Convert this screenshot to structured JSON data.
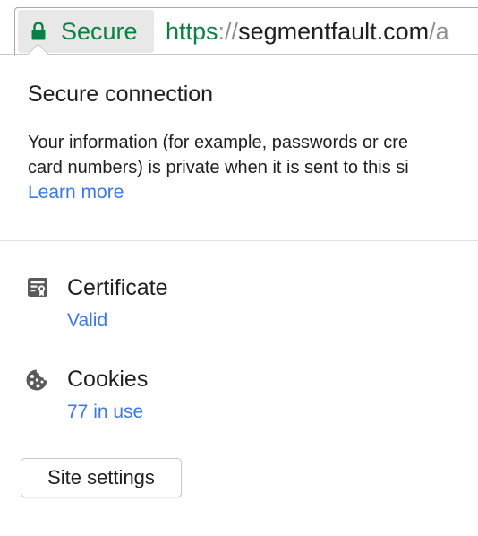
{
  "omnibox": {
    "security_label": "Secure",
    "url": {
      "scheme": "https",
      "separator": "://",
      "host": "segmentfault.com",
      "path": "/a"
    },
    "security_icon": "lock-icon"
  },
  "bubble": {
    "title": "Secure connection",
    "description_lines": [
      "Your information (for example, passwords or cre",
      "card numbers) is private when it is sent to this si"
    ],
    "learn_more": "Learn more",
    "certificate": {
      "icon": "certificate-icon",
      "title": "Certificate",
      "link": "Valid"
    },
    "cookies": {
      "icon": "cookie-icon",
      "title": "Cookies",
      "link": "77 in use"
    },
    "site_settings_label": "Site settings"
  },
  "colors": {
    "secure_green": "#0b8043",
    "link_blue": "#3b78e7",
    "text": "#202020",
    "icon_gray": "#5a5a5a",
    "chip_bg": "#e8e8e8"
  }
}
